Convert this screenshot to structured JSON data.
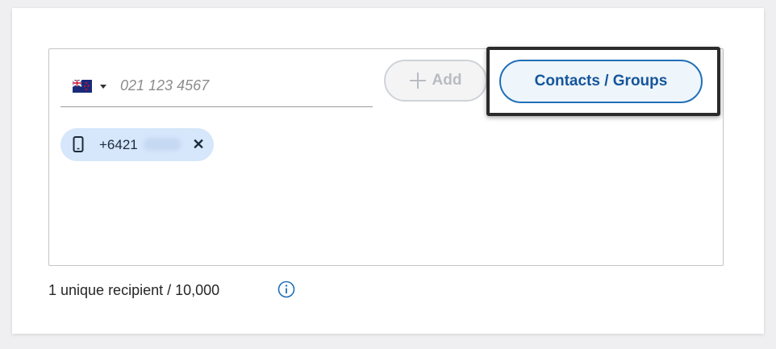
{
  "phone_input": {
    "country_flag": "new-zealand-flag-icon",
    "placeholder": "021 123 4567",
    "value": ""
  },
  "add_button": {
    "label": "Add",
    "icon": "plus-icon",
    "enabled": false
  },
  "contacts_button": {
    "label": "Contacts / Groups"
  },
  "recipient_chip": {
    "icon": "mobile-phone-icon",
    "number": "+6421",
    "remove_icon": "close-icon",
    "remove_glyph": "✕"
  },
  "recipient_count": {
    "text": "1 unique recipient / 10,000",
    "info_icon": "info-icon"
  },
  "colors": {
    "accent": "#1f6fb8",
    "chip_background": "#d6e6fb",
    "disabled": "#b8bcc2"
  }
}
